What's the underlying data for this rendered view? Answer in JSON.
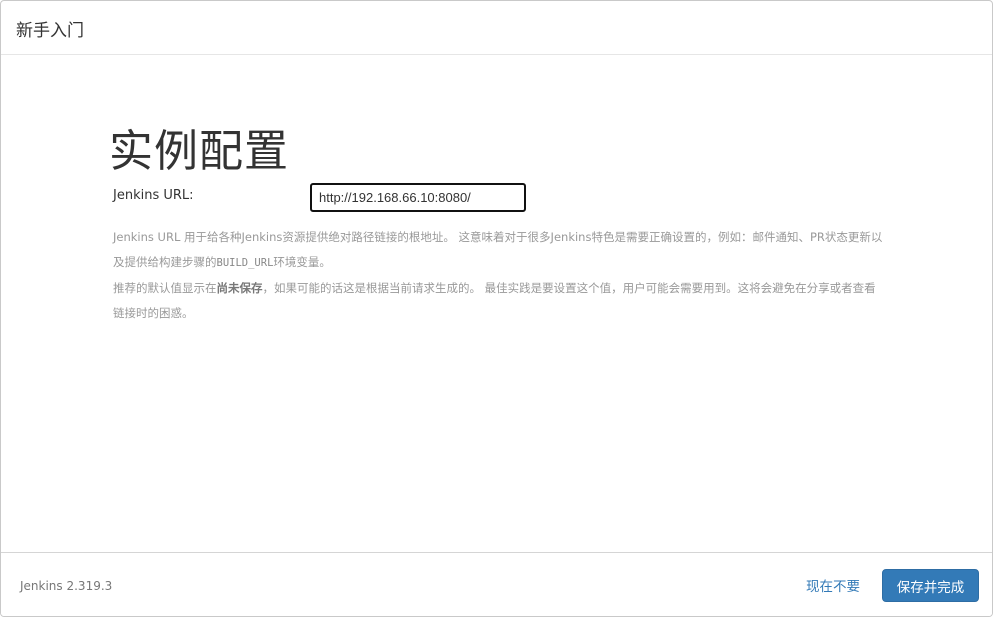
{
  "header": {
    "title": "新手入门"
  },
  "main": {
    "title": "实例配置",
    "url_label": "Jenkins URL:",
    "url_value": "http://192.168.66.10:8080/",
    "help": {
      "p1_a": "Jenkins URL 用于给各种Jenkins资源提供绝对路径链接的根地址。 这意味着对于很多Jenkins特色是需要正确设置的，例如：邮件通知、PR状态更新以及提供给构建步骤的",
      "p1_code": "BUILD_URL",
      "p1_b": "环境变量。",
      "p2_a": "推荐的默认值显示在",
      "p2_strong": "尚未保存",
      "p2_b": "，如果可能的话这是根据当前请求生成的。 最佳实践是要设置这个值，用户可能会需要用到。这将会避免在分享或者查看链接时的困惑。"
    }
  },
  "footer": {
    "version": "Jenkins 2.319.3",
    "skip_label": "现在不要",
    "save_label": "保存并完成"
  }
}
